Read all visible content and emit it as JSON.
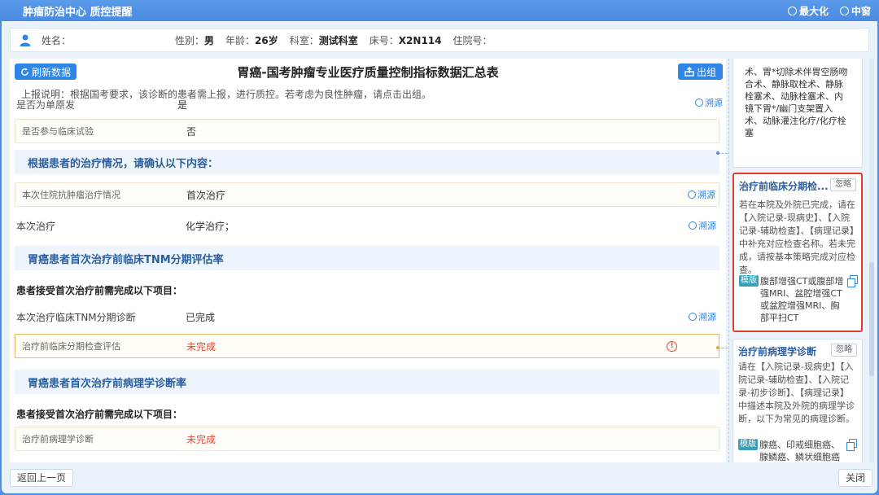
{
  "window": {
    "title": "肿瘤防治中心 质控提醒",
    "maximize_label": "最大化",
    "restore_label": "中窗"
  },
  "patient": {
    "name_label": "姓名：",
    "gender_label": "性别：",
    "gender": "男",
    "age_label": "年龄：",
    "age": "26岁",
    "dept_label": "科室：",
    "dept": "测试科室",
    "bed_label": "床号：",
    "bed": "X2N114",
    "admission_label": "住院号："
  },
  "main": {
    "refresh_label": "刷新数据",
    "title": "胃癌-国考肿瘤专业医疗质量控制指标数据汇总表",
    "report_label": "出组",
    "note": "上报说明：根据国考要求，该诊断的患者需上报，进行质控。若考虑为良性肿瘤，请点击出组。",
    "cut_label": "是否为单原发",
    "cut_value": "是",
    "trace_label": "溯源",
    "rows": [
      {
        "label": "是否参与临床试验",
        "value": "否"
      },
      {
        "section": "根据患者的治疗情况，请确认以下内容："
      },
      {
        "label": "本次住院抗肿瘤治疗情况",
        "value": "首次治疗"
      },
      {
        "label": "本次治疗",
        "value": "化学治疗；"
      },
      {
        "section": "胃癌患者首次治疗前临床TNM分期评估率"
      },
      {
        "subhead": "患者接受首次治疗前需完成以下项目："
      },
      {
        "label": "本次治疗临床TNM分期诊断",
        "value": "已完成"
      },
      {
        "label": "治疗前临床分期检查评估",
        "value": "未完成"
      },
      {
        "section": "胃癌患者首次治疗前病理学诊断率"
      },
      {
        "subhead": "患者接受首次治疗前需完成以下项目："
      },
      {
        "label": "治疗前病理学诊断",
        "value": "未完成"
      }
    ]
  },
  "side": {
    "top_card_text": "术、胃*切除术伴胃空肠吻合术、静脉取栓术、静脉栓塞术、动脉栓塞术、内镜下胃*/幽门支架置入术、动脉灌注化疗/化疗栓塞",
    "ignore_label": "忽略",
    "template_tag": "模版",
    "cards": [
      {
        "title": "治疗前临床分期检...",
        "desc": "若在本院及外院已完成，请在【入院记录-现病史】、【入院记录-辅助检查】、【病理记录】中补充对应检查名称。若未完成，请按基本策略完成对应检查。",
        "template": "腹部增强CT或腹部增强MRI、盆腔增强CT或盆腔增强MRI、胸部平扫CT"
      },
      {
        "title": "治疗前病理学诊断",
        "desc": "请在【入院记录-现病史】【入院记录-辅助检查】、【入院记录-初步诊断】、【病理记录】中描述本院及外院的病理学诊断，以下为常见的病理诊断。",
        "template": "腺癌、印戒细胞癌、腺鳞癌、鳞状细胞癌"
      }
    ]
  },
  "footer": {
    "back_label": "返回上一页",
    "close_label": "关闭"
  },
  "colors": {
    "accent": "#2f86e6",
    "title_bar": "#4a8ae0",
    "alert": "#e04a3c",
    "highlight_border": "#e53a2f"
  }
}
